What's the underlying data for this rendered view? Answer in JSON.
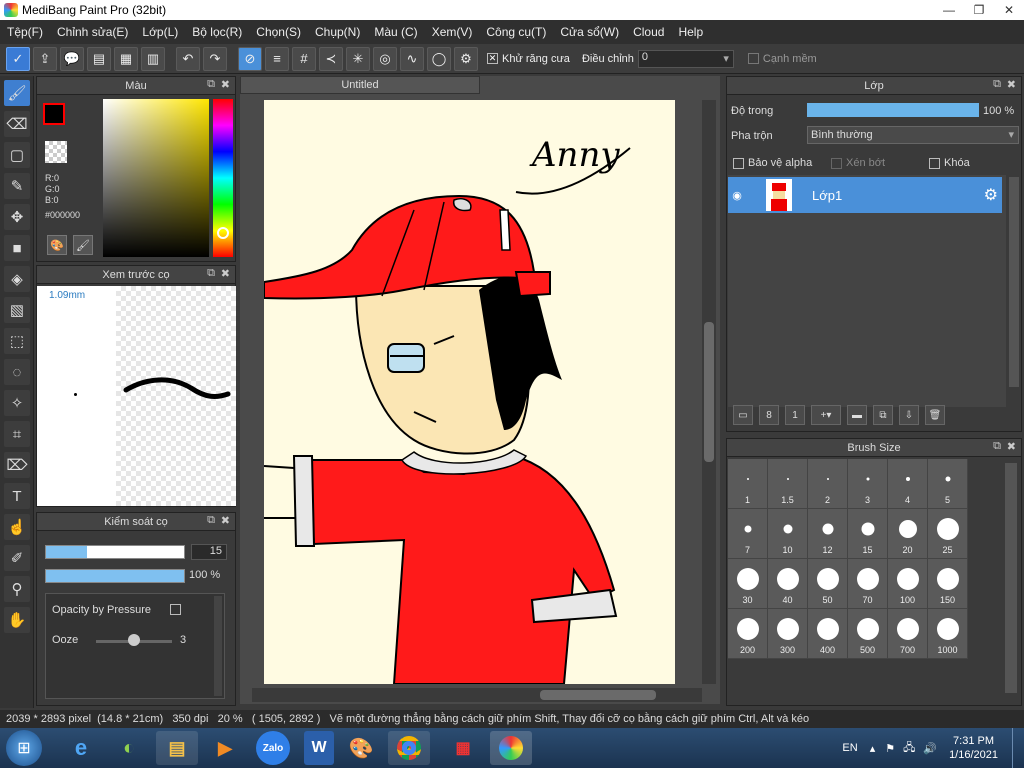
{
  "window": {
    "title": "MediBang Paint Pro (32bit)",
    "minimize": "—",
    "restore": "❐",
    "close": "✕"
  },
  "menu": [
    "Tệp(F)",
    "Chỉnh sửa(E)",
    "Lớp(L)",
    "Bộ lọc(R)",
    "Chọn(S)",
    "Chụp(N)",
    "Màu (C)",
    "Xem(V)",
    "Công cụ(T)",
    "Cửa sổ(W)",
    "Cloud",
    "Help"
  ],
  "toolbar": {
    "antialias_label": "Khử răng cưa",
    "correction_label": "Điều chỉnh",
    "correction_value": "0",
    "soft_edge_label": "Cạnh mềm"
  },
  "color_panel": {
    "title": "Màu",
    "r": "R:0",
    "g": "G:0",
    "b": "B:0",
    "hex": "#000000",
    "foreground": "#000000",
    "outline": "#ff0000"
  },
  "brush_preview": {
    "title": "Xem trước cọ",
    "size": "1.09mm"
  },
  "brush_control": {
    "title": "Kiểm soát cọ",
    "size_value": "15",
    "opacity_value": "100 %",
    "opacity_by_pressure": "Opacity by Pressure",
    "ooze_label": "Ooze",
    "ooze_value": "3",
    "size_fraction": 0.3,
    "opacity_fraction": 1.0,
    "ooze_fraction": 0.5
  },
  "document": {
    "tab": "Untitled",
    "signature": "Anny"
  },
  "layers": {
    "title": "Lớp",
    "opacity_label": "Độ trong",
    "opacity_value": "100 %",
    "blend_label": "Pha trộn",
    "blend_value": "Bình thường",
    "protect_alpha": "Bảo vệ alpha",
    "clipping": "Xén bớt",
    "lock": "Khóa",
    "layer_name": "Lớp1"
  },
  "brush_size": {
    "title": "Brush Size",
    "sizes": [
      "1",
      "1.5",
      "2",
      "3",
      "4",
      "5",
      "7",
      "10",
      "12",
      "15",
      "20",
      "25",
      "30",
      "40",
      "50",
      "70",
      "100",
      "150",
      "200",
      "300",
      "400",
      "500",
      "700",
      "1000"
    ]
  },
  "status": {
    "dimensions": "2039 * 2893 pixel",
    "cm": "(14.8 * 21cm)",
    "dpi": "350 dpi",
    "zoom": "20 %",
    "coords": "( 1505, 2892 )",
    "hint": "Vẽ một đường thẳng bằng cách giữ phím Shift, Thay đổi cỡ cọ bằng cách giữ phím Ctrl, Alt và kéo"
  },
  "taskbar": {
    "zalo": "Zalo",
    "word": "W",
    "lang": "EN",
    "time": "7:31 PM",
    "date": "1/16/2021"
  }
}
